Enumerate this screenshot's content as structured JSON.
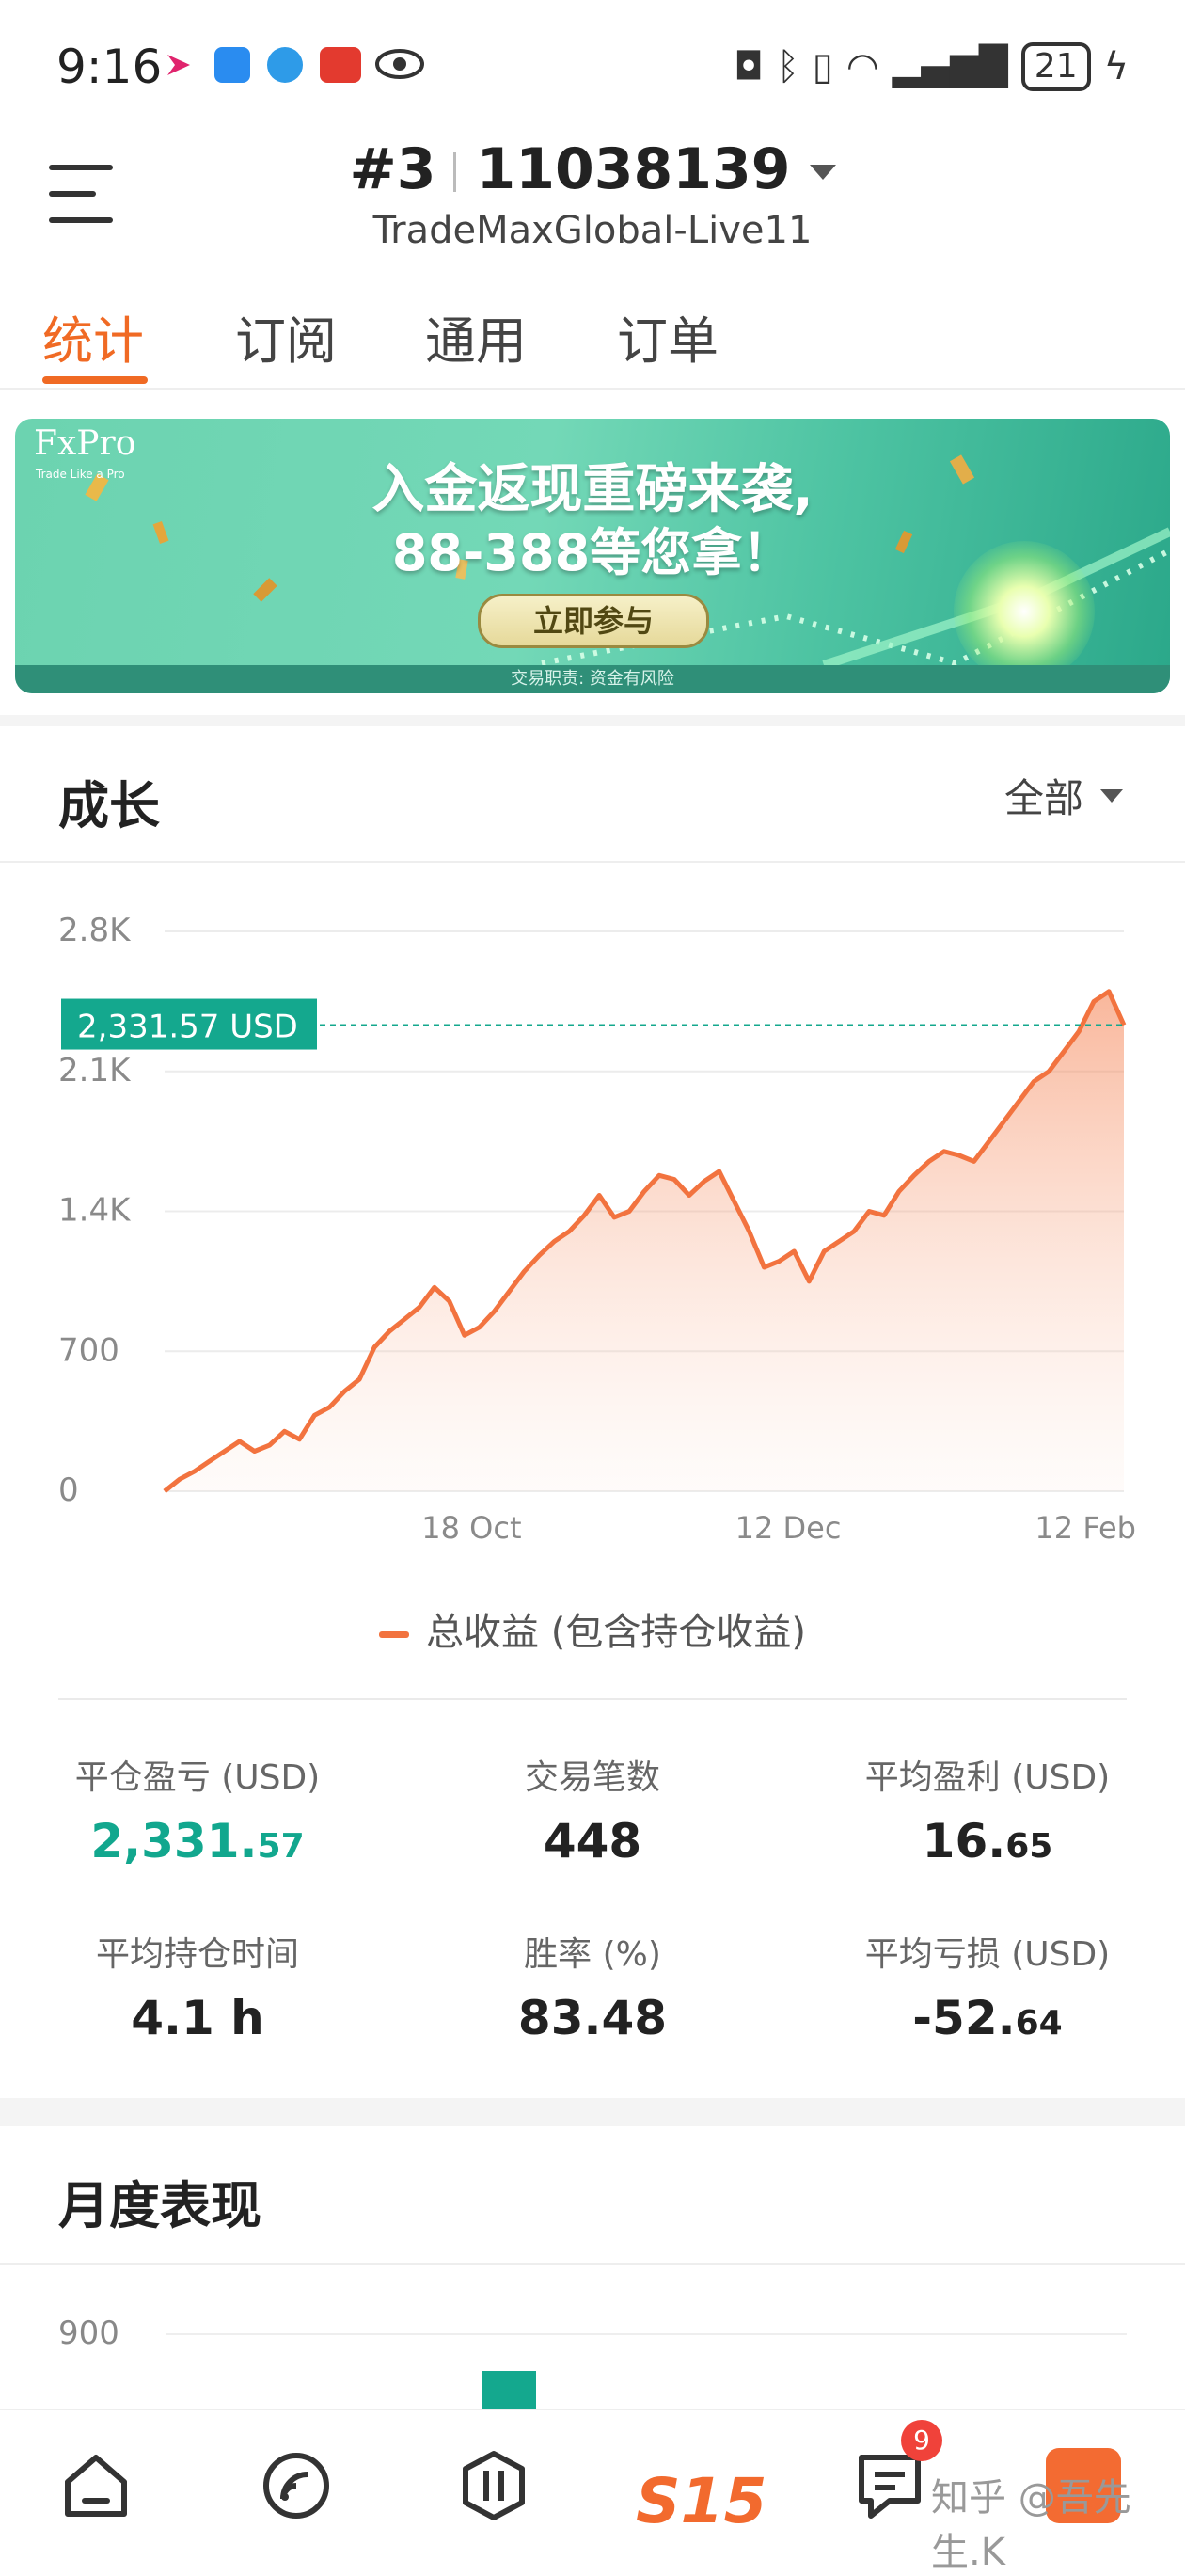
{
  "status_bar": {
    "time": "9:16",
    "battery": "21",
    "icons": [
      "app-icon",
      "chat-icon",
      "browser-icon",
      "news-icon",
      "eye-icon",
      "nfc-icon",
      "bluetooth-icon",
      "vibrate-icon",
      "wifi-icon",
      "signal-icon",
      "charging-icon"
    ]
  },
  "header": {
    "account_number": "#3",
    "account_id": "11038139",
    "server": "TradeMaxGlobal-Live11"
  },
  "tabs": [
    {
      "label": "统计",
      "active": true
    },
    {
      "label": "订阅",
      "active": false
    },
    {
      "label": "通用",
      "active": false
    },
    {
      "label": "订单",
      "active": false
    }
  ],
  "banner": {
    "brand": "FxPro",
    "tagline": "Trade Like a Pro",
    "line1": "入金返现重磅来袭,",
    "line2": "88-388等您拿！",
    "button": "立即参与",
    "footer": "交易职责: 资金有风险"
  },
  "growth": {
    "title": "成长",
    "range": "全部"
  },
  "chart_data": {
    "type": "area",
    "y_ticks": [
      "2.8K",
      "2.1K",
      "1.4K",
      "700",
      "0"
    ],
    "ylim": [
      0,
      2800
    ],
    "x_ticks": [
      "18 Oct",
      "12 Dec",
      "12 Feb"
    ],
    "current_value_label": "2,331.57 USD",
    "current_value": 2331.57,
    "color": "#f2733f",
    "series": [
      {
        "name": "总收益 (包含持仓收益)",
        "values": [
          0,
          60,
          100,
          150,
          200,
          250,
          200,
          230,
          300,
          260,
          380,
          420,
          500,
          560,
          720,
          800,
          860,
          920,
          1020,
          950,
          780,
          820,
          900,
          1000,
          1100,
          1180,
          1250,
          1300,
          1380,
          1480,
          1370,
          1400,
          1500,
          1580,
          1560,
          1480,
          1550,
          1600,
          1450,
          1300,
          1120,
          1150,
          1200,
          1050,
          1200,
          1250,
          1300,
          1400,
          1380,
          1500,
          1580,
          1650,
          1700,
          1680,
          1650,
          1750,
          1850,
          1950,
          2050,
          2100,
          2200,
          2300,
          2450,
          2500,
          2331.57
        ]
      }
    ],
    "legend": "总收益 (包含持仓收益)"
  },
  "stats": [
    {
      "label": "平仓盈亏 (USD)",
      "int": "2,331.",
      "dec": "57",
      "green": true
    },
    {
      "label": "交易笔数",
      "int": "448",
      "dec": "",
      "green": false
    },
    {
      "label": "平均盈利 (USD)",
      "int": "16.",
      "dec": "65",
      "green": false
    },
    {
      "label": "平均持仓时间",
      "int": "4.1 h",
      "dec": "",
      "green": false
    },
    {
      "label": "胜率 (%)",
      "int": "83.48",
      "dec": "",
      "green": false
    },
    {
      "label": "平均亏损 (USD)",
      "int": "-52.",
      "dec": "64",
      "green": false
    }
  ],
  "monthly": {
    "title": "月度表现",
    "y_tick": "900"
  },
  "bottom_nav": {
    "items": [
      "home-icon",
      "signal-feed-icon",
      "trade-icon",
      "s15-logo",
      "messages-icon"
    ],
    "s15_label": "S15",
    "badge": "9",
    "watermark": "知乎 @吾先生.K"
  }
}
